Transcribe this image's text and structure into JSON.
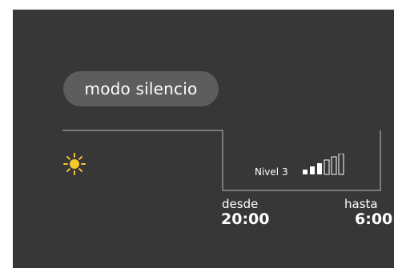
{
  "screen": {
    "background": "#373737",
    "accent_sun": "#f6c72f",
    "accent_moon": "#6ec8f2"
  },
  "mode": {
    "label": "modo silencio"
  },
  "level": {
    "label": "Nivel 3",
    "current": 3,
    "max": 6
  },
  "schedule": {
    "from_label": "desde",
    "from_time": "20:00",
    "to_label": "hasta",
    "to_time": "6:00",
    "day_icon": "sun-icon",
    "night_icon": "moon-icon"
  }
}
